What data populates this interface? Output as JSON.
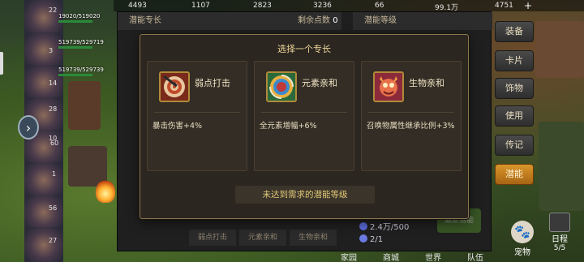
{
  "topbar": {
    "values": [
      "4493",
      "1107",
      "2823",
      "3236",
      "66",
      "99.1万",
      "4751"
    ],
    "plus": "+"
  },
  "heroes": {
    "numbers": [
      "22",
      "3",
      "14",
      "28",
      "10",
      "60",
      "1",
      "56",
      "27"
    ],
    "hp_texts": [
      "19020/519020",
      "519739/529719",
      "519739/529739"
    ],
    "expand": "›"
  },
  "right_menu": {
    "items": [
      {
        "label": "装备",
        "active": false
      },
      {
        "label": "卡片",
        "active": false
      },
      {
        "label": "饰物",
        "active": false
      },
      {
        "label": "使用",
        "active": false
      },
      {
        "label": "传记",
        "active": false
      },
      {
        "label": "潜能",
        "active": true
      }
    ]
  },
  "base_panel": {
    "left_header": "潜能专长",
    "right_header": "潜能等级",
    "remaining_label": "剩余点数",
    "remaining_value": "0",
    "bottom_tabs": [
      "弱点打击",
      "元素亲和",
      "生物亲和"
    ],
    "stats": [
      {
        "value": "2.4万/500",
        "color": "#5a6ad8"
      },
      {
        "value": "2/1",
        "color": "#6a7ae0"
      }
    ],
    "green_button": "激发潜能"
  },
  "bottom_nav": {
    "items": [
      "家园",
      "商城",
      "世界",
      "队伍"
    ],
    "pet_label": "宠物",
    "pet_icon": "paw-icon",
    "schedule_label": "日程",
    "schedule_count": "5/5"
  },
  "modal": {
    "title": "选择一个专长",
    "cards": [
      {
        "name": "弱点打击",
        "desc": "暴击伤害+4%",
        "icon": "target-icon",
        "color": "#c04a2a"
      },
      {
        "name": "元素亲和",
        "desc": "全元素增幅+6%",
        "icon": "vortex-icon",
        "color": "#4a8a3a"
      },
      {
        "name": "生物亲和",
        "desc": "召唤物属性继承比例+3%",
        "icon": "creature-icon",
        "color": "#c83a5a"
      }
    ],
    "requirement": "未达到需求的潜能等级"
  }
}
